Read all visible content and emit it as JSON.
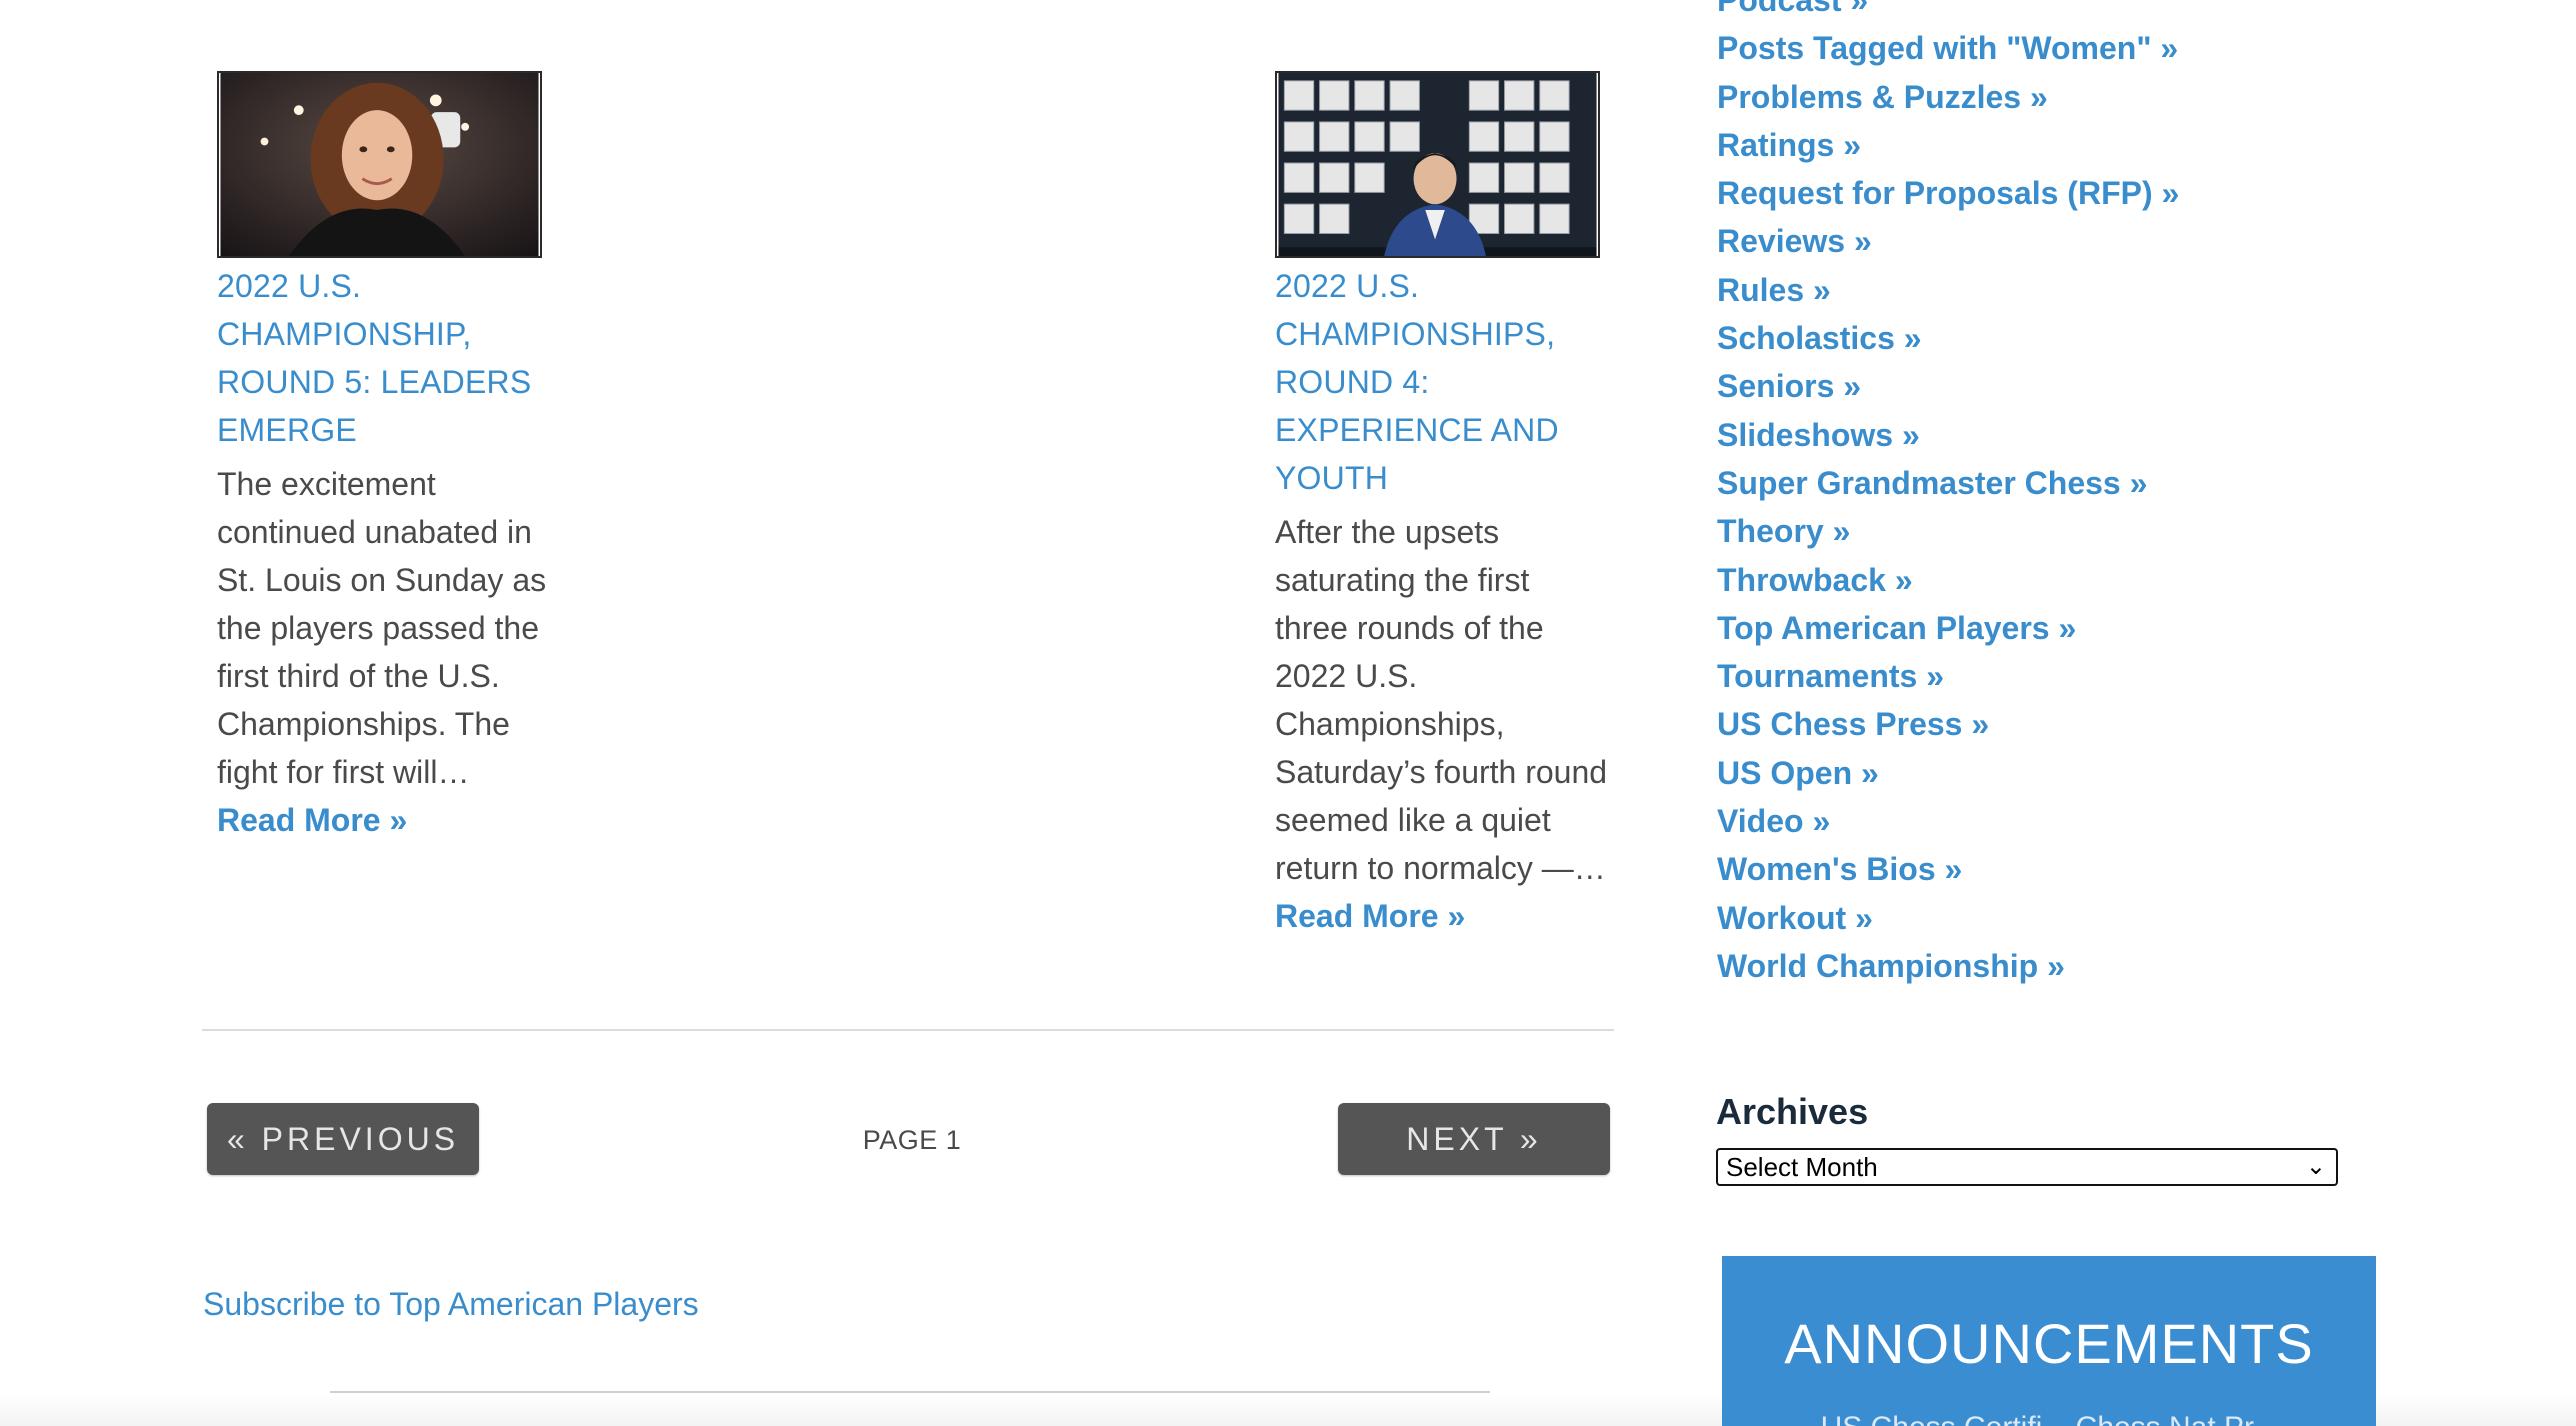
{
  "articles": [
    {
      "title": "2022 U.S. Championship, Round 5: Leaders Emerge",
      "excerpt": "The excitement continued unabated in St. Louis on Sunday as the players passed the first third of the U.S. Championships. The fight for first will…",
      "read_more": "Read More »"
    },
    {
      "title": "2022 U.S. Championships, Round 4: Experience and Youth",
      "excerpt": "After the upsets saturating the first three rounds of the 2022 U.S. Championships, Saturday’s fourth round seemed like a quiet return to normalcy —…",
      "read_more": "Read More »"
    }
  ],
  "pagination": {
    "previous": "« Previous",
    "page": "PAGE 1",
    "next": "Next »"
  },
  "subscribe": "Subscribe to Top American Players",
  "sidebar": {
    "categories": [
      "Podcast »",
      "Posts Tagged with \"Women\" »",
      "Problems & Puzzles »",
      "Ratings »",
      "Request for Proposals (RFP) »",
      "Reviews »",
      "Rules »",
      "Scholastics »",
      "Seniors »",
      "Slideshows »",
      "Super Grandmaster Chess »",
      "Theory »",
      "Throwback »",
      "Top American Players »",
      "Tournaments »",
      "US Chess Press »",
      "US Open »",
      "Video »",
      "Women's Bios »",
      "Workout »",
      "World Championship »"
    ],
    "archives": {
      "title": "Archives",
      "selected": "Select Month"
    },
    "announcements": {
      "title": "ANNOUNCEMENTS",
      "subtitle": "US Chess Certifi... Chess Nat Pr..."
    }
  },
  "colors": {
    "link": "#3a8dcc",
    "button": "#555555",
    "announce_bg": "#3a8dd0"
  }
}
